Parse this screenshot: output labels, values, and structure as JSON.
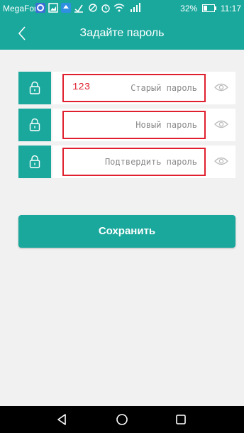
{
  "status_bar": {
    "carrier": "MegaFon",
    "battery": "32%",
    "time": "11:17"
  },
  "header": {
    "title": "Задайте пароль",
    "back_icon": "chevron-left-icon"
  },
  "form": {
    "fields": [
      {
        "value": "123",
        "placeholder": "Старый пароль",
        "icon": "lock-icon"
      },
      {
        "value": "",
        "placeholder": "Новый пароль",
        "icon": "lock-icon"
      },
      {
        "value": "",
        "placeholder": "Подтвердить пароль",
        "icon": "lock-icon"
      }
    ],
    "visibility_icon": "eye-icon"
  },
  "save_label": "Сохранить",
  "colors": {
    "accent": "#1aa89d",
    "highlight": "#e0202e",
    "background": "#f1f1f1"
  },
  "nav_bar": {
    "icons": [
      "back-triangle-icon",
      "home-circle-icon",
      "recents-square-icon"
    ]
  }
}
